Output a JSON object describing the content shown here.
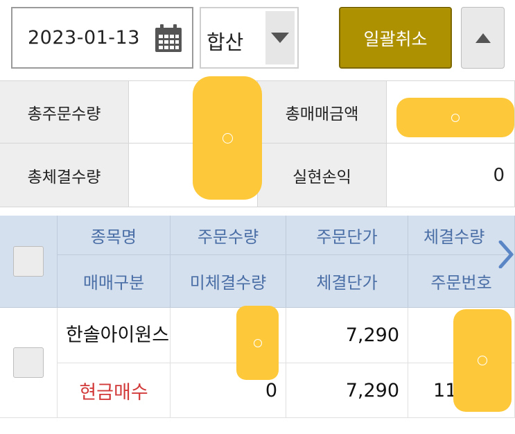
{
  "toolbar": {
    "date_value": "2023-01-13",
    "mode_select": "합산",
    "cancel_all_label": "일괄취소"
  },
  "summary": {
    "total_order_qty_label": "총주문수량",
    "total_trade_amount_label": "총매매금액",
    "total_filled_qty_label": "총체결수량",
    "realized_pnl_label": "실현손익",
    "realized_pnl_value": "0"
  },
  "orders": {
    "headers_row1": [
      "종목명",
      "주문수량",
      "주문단가",
      "체결수량"
    ],
    "headers_row2": [
      "매매구분",
      "미체결수량",
      "체결단가",
      "주문번호"
    ],
    "rows": [
      {
        "stock_name": "한솔아이원스",
        "order_price": "7,290",
        "trade_type": "현금매수",
        "unfilled_qty": "0",
        "filled_price": "7,290",
        "order_no_partial": "11"
      }
    ]
  },
  "colors": {
    "accent_button": "#ad9100",
    "header_bg": "#d5e0ee",
    "header_text": "#4a6ea6",
    "buy_text": "#d23a3a",
    "redaction": "#fdc93a"
  }
}
